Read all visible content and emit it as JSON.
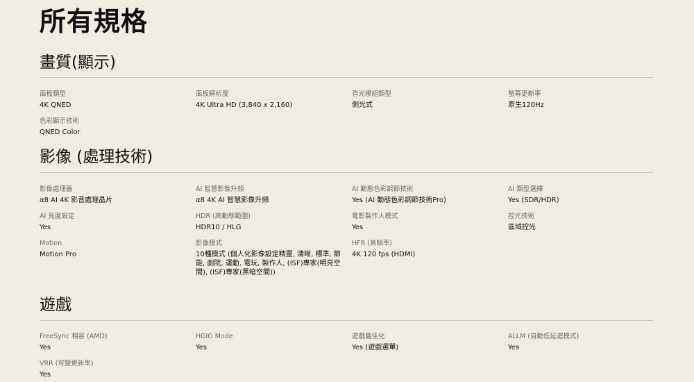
{
  "page_title": "所有規格",
  "sections": [
    {
      "title": "畫質(顯示)",
      "specs": [
        {
          "label": "面板類型",
          "value": "4K QNED"
        },
        {
          "label": "面板解析度",
          "value": "4K Ultra HD (3,840 x 2,160)"
        },
        {
          "label": "背光模組類型",
          "value": "側光式"
        },
        {
          "label": "螢幕更新率",
          "value": "原生120Hz"
        },
        {
          "label": "色彩顯示技術",
          "value": "QNED Color"
        }
      ]
    },
    {
      "title": "影像 (處理技術)",
      "specs": [
        {
          "label": "影像處理器",
          "value": "α8 AI 4K 影音處理晶片"
        },
        {
          "label": "AI 智慧影像升頻",
          "value": "α8 4K AI 智慧影像升頻"
        },
        {
          "label": "AI 動態色彩調節技術",
          "value": "Yes (AI 動態色彩調節技術Pro)"
        },
        {
          "label": "AI 類型選擇",
          "value": "Yes (SDR/HDR)"
        },
        {
          "label": "AI 亮度設定",
          "value": "Yes"
        },
        {
          "label": "HDR (高動態範圍)",
          "value": "HDR10 / HLG"
        },
        {
          "label": "電影製作人模式",
          "value": "Yes"
        },
        {
          "label": "控光技術",
          "value": "區域控光"
        },
        {
          "label": "Motion",
          "value": "Motion Pro"
        },
        {
          "label": "影像模式",
          "value": "10種模式 (個人化影像設定精靈, 清晰, 標準, 節能, 劇院, 運動, 電玩, 製作人, (ISF)專家(明亮空間), (ISF)專家(黑暗空間))"
        },
        {
          "label": "HFR (高幀率)",
          "value": "4K 120 fps (HDMI)"
        }
      ]
    },
    {
      "title": "遊戲",
      "specs": [
        {
          "label": "FreeSync 相容 (AMD)",
          "value": "Yes"
        },
        {
          "label": "HGIG Mode",
          "value": "Yes"
        },
        {
          "label": "遊戲最佳化",
          "value": "Yes (遊戲選單)"
        },
        {
          "label": "ALLM (自動低延遲模式)",
          "value": "Yes"
        },
        {
          "label": "VRR (可變更新率)",
          "value": "Yes"
        }
      ]
    }
  ]
}
